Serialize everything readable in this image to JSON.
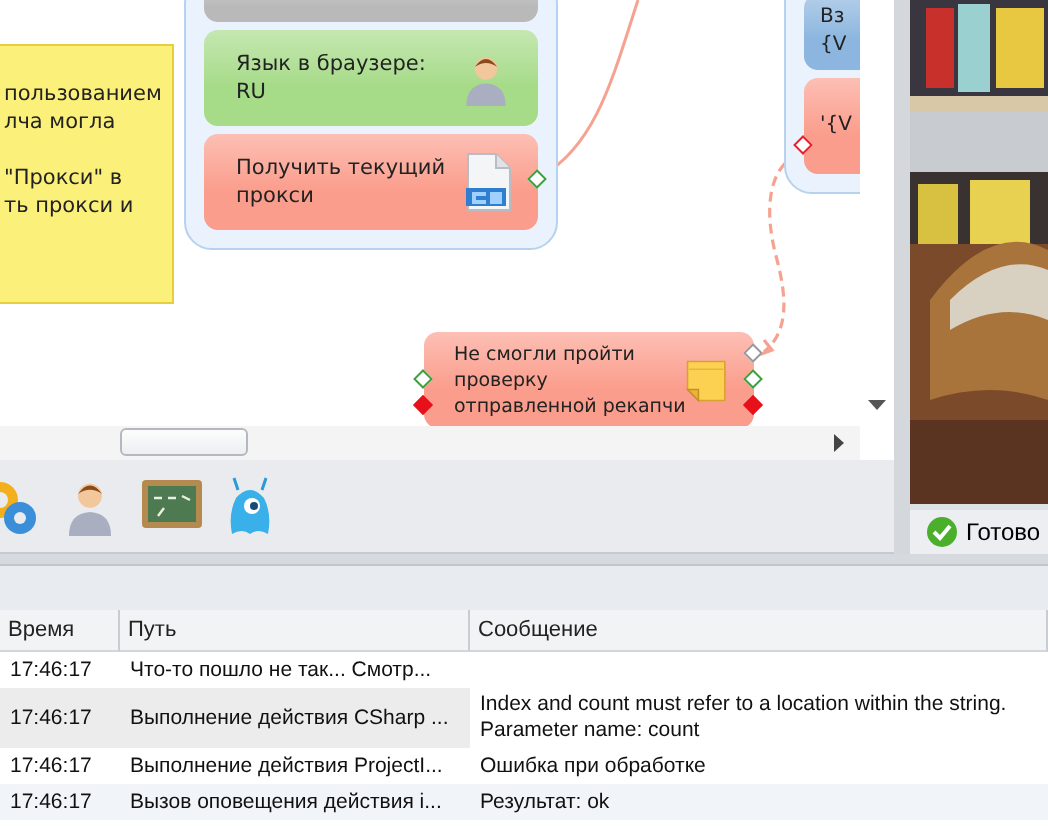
{
  "canvas": {
    "note": {
      "text": "пользованием\nлча могла\n\n\"Прокси\" в\nть прокси и"
    },
    "groups": [
      {
        "nodes": [
          {
            "color": "#b9b9b9"
          },
          {
            "text": "Язык в браузере:\nRU",
            "color": "#a6db88",
            "kind": "person"
          },
          {
            "text": "Получить текущий\nпрокси",
            "color": "#fb9d8c",
            "kind": "script",
            "out_ports": [
              {
                "color": "#3ca03c",
                "filled": false
              }
            ]
          }
        ]
      },
      {
        "nodes": [
          {
            "text": "Вз\n{V",
            "color": "#8cb6df"
          },
          {
            "text": "'{V",
            "color": "#fb9d8c",
            "in_ports": [
              {
                "color": "#e8202a",
                "filled": false
              }
            ]
          }
        ]
      }
    ],
    "node": {
      "text": "Не смогли пройти\nпроверку\nотправленной рекапчи",
      "color": "#fb9d8c",
      "kind": "note",
      "in_ports": [
        {
          "color": "#3ca03c",
          "filled": false
        },
        {
          "color": "#e8101a",
          "filled": true
        }
      ],
      "out_ports": [
        {
          "color": "#9a9a9a",
          "filled": false
        },
        {
          "color": "#3ca03c",
          "filled": false
        },
        {
          "color": "#e8101a",
          "filled": true
        }
      ]
    }
  },
  "toolbar": [
    {
      "kind": "gears"
    },
    {
      "kind": "person"
    },
    {
      "kind": "chalkboard"
    },
    {
      "kind": "monster"
    }
  ],
  "status": {
    "text": "Готово"
  },
  "log": {
    "columns": [
      "Время",
      "Путь",
      "Сообщение"
    ],
    "rows": [
      {
        "time": "17:46:17",
        "path": "Что-то пошло не так... Смотр...",
        "selected": false
      },
      {
        "time": "17:46:17",
        "path": "Выполнение действия CSharp ...",
        "message": "Index and count must refer to a location within the string.\nParameter name: count",
        "selected": true
      },
      {
        "time": "17:46:17",
        "path": "Выполнение действия ProjectI...",
        "message": "Ошибка при обработке",
        "selected": false
      },
      {
        "time": "17:46:17",
        "path": "Вызов оповещения действия i...",
        "message": "Результат: ok",
        "selected": false
      }
    ]
  }
}
